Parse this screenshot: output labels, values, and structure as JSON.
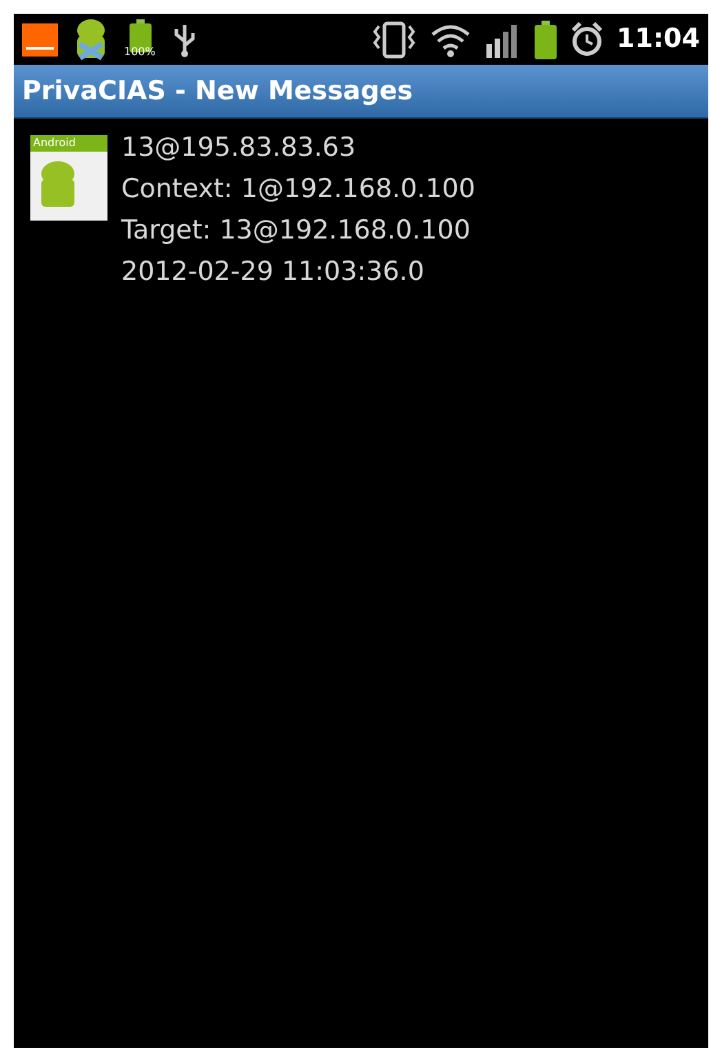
{
  "status_bar": {
    "battery_label": "100%",
    "time": "11:04"
  },
  "title_bar": {
    "title": "PrivaCIAS - New Messages"
  },
  "messages": [
    {
      "icon_label": "Android",
      "lines": [
        "13@195.83.83.63",
        "Context: 1@192.168.0.100",
        "Target: 13@192.168.0.100",
        "2012-02-29 11:03:36.0"
      ]
    }
  ]
}
